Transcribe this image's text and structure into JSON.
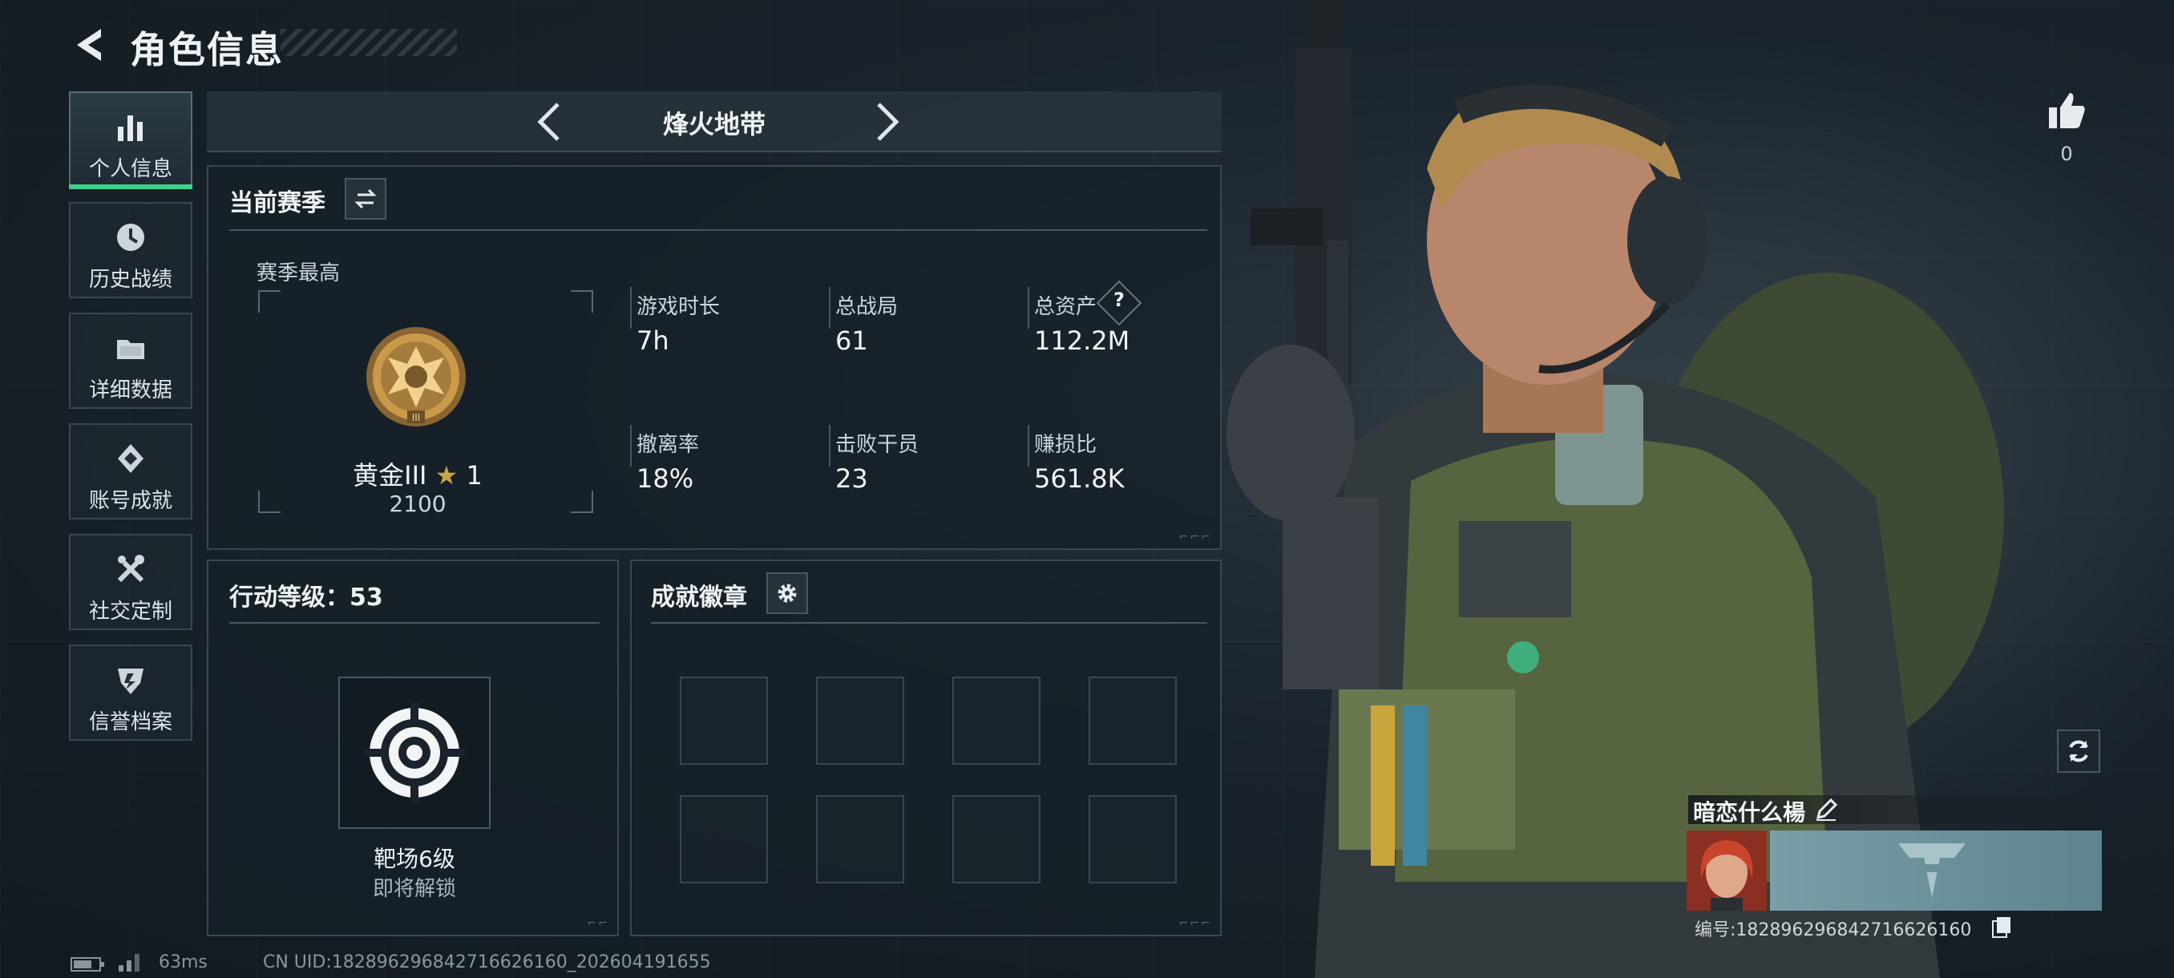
{
  "header": {
    "title": "角色信息"
  },
  "sidebar": {
    "items": [
      {
        "label": "个人信息",
        "icon": "bar-chart-icon",
        "active": true
      },
      {
        "label": "历史战绩",
        "icon": "clock-icon",
        "active": false
      },
      {
        "label": "详细数据",
        "icon": "folder-icon",
        "active": false
      },
      {
        "label": "账号成就",
        "icon": "achievement-icon",
        "active": false
      },
      {
        "label": "社交定制",
        "icon": "tools-icon",
        "active": false
      },
      {
        "label": "信誉档案",
        "icon": "shield-icon",
        "active": false
      }
    ]
  },
  "mode_selector": {
    "current": "烽火地带"
  },
  "season": {
    "title": "当前赛季",
    "best_label": "赛季最高",
    "rank_name": "黄金III",
    "rank_stars": "1",
    "rank_points": "2100",
    "stats": [
      {
        "label": "游戏时长",
        "value": "7h"
      },
      {
        "label": "总战局",
        "value": "61"
      },
      {
        "label": "总资产",
        "value": "112.2M",
        "help": "?"
      },
      {
        "label": "撤离率",
        "value": "18%"
      },
      {
        "label": "击败干员",
        "value": "23"
      },
      {
        "label": "赚损比",
        "value": "561.8K"
      }
    ]
  },
  "action_level": {
    "title": "行动等级：53",
    "unlock_name": "靶场6级",
    "unlock_status": "即将解锁"
  },
  "badges": {
    "title": "成就徽章"
  },
  "likes": {
    "count": "0"
  },
  "player": {
    "name": "暗恋什么楊",
    "id_line": "编号:1828962968427166261​60"
  },
  "status_bar": {
    "ping": "63ms",
    "uid": "CN UID:1828962968427166​26160_202604191655"
  },
  "colors": {
    "accent": "#3fd08c",
    "panel_border": "#3a4650",
    "gold": "#c99a4a"
  }
}
